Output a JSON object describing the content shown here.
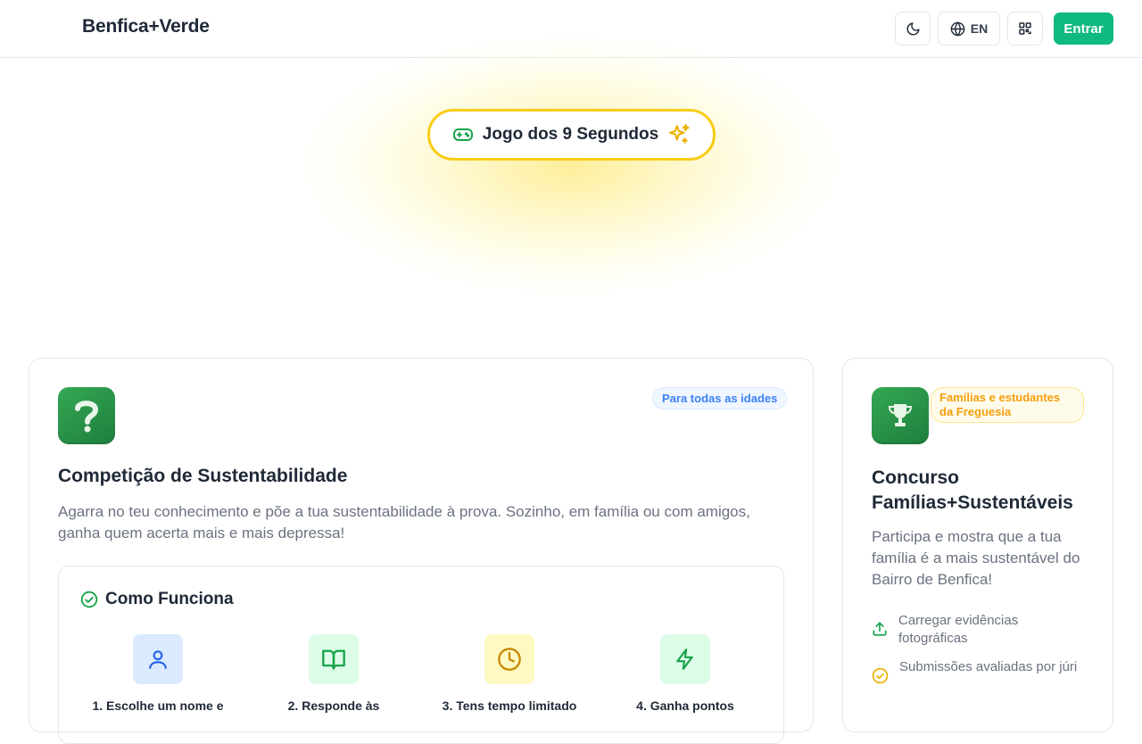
{
  "header": {
    "brand": "Benfica+Verde",
    "language": "EN",
    "login_label": "Entrar"
  },
  "hero": {
    "game_label": "Jogo dos 9 Segundos"
  },
  "competition_card": {
    "badge": "Para todas as idades",
    "title": "Competição de Sustentabilidade",
    "description": "Agarra no teu conhecimento e põe a tua sustentabilidade à prova. Sozinho, em família ou com amigos, ganha quem acerta mais e mais depressa!",
    "how_title": "Como Funciona",
    "steps": [
      {
        "label": "1. Escolhe um nome e",
        "icon": "user-icon",
        "bg": "#dbeafe",
        "color": "#2563eb"
      },
      {
        "label": "2. Responde às",
        "icon": "book-open-icon",
        "bg": "#dcfce7",
        "color": "#16a34a"
      },
      {
        "label": "3. Tens tempo limitado",
        "icon": "clock-icon",
        "bg": "#fef9c3",
        "color": "#ca8a04"
      },
      {
        "label": "4. Ganha pontos",
        "icon": "lightning-icon",
        "bg": "#dcfce7",
        "color": "#16a34a"
      }
    ]
  },
  "contest_card": {
    "badge": "Famílias e estudantes da Freguesia",
    "title": "Concurso Famílias+Sustentáveis",
    "description": "Participa e mostra que a tua família é a mais sustentável do Bairro de Benfica!",
    "features": [
      {
        "label": "Carregar evidências fotográficas",
        "icon": "upload-icon"
      },
      {
        "label": "Submissões avaliadas por júri",
        "icon": "check-circle-icon"
      }
    ]
  },
  "colors": {
    "accent_green": "#10b981",
    "highlight_yellow": "#facc15",
    "badge_blue": "#3b82f6",
    "badge_amber": "#f59e0b"
  }
}
